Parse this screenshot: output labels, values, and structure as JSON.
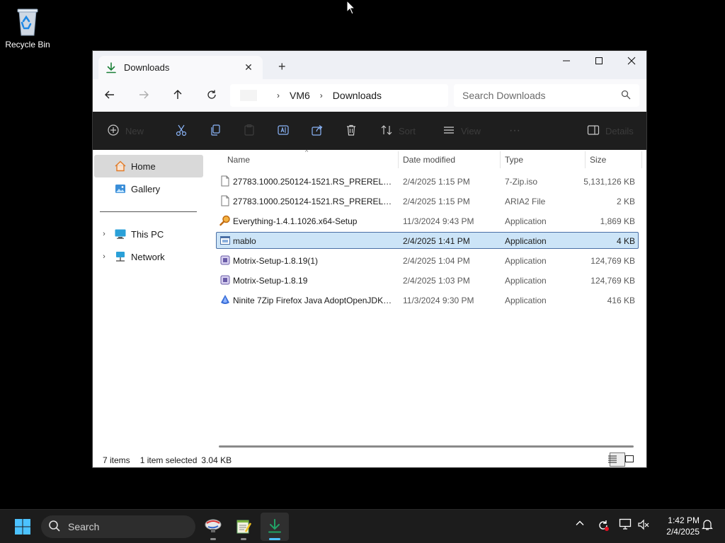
{
  "desktop": {
    "recycle_bin_label": "Recycle Bin"
  },
  "window": {
    "tab_title": "Downloads",
    "new_tab_symbol": "+",
    "close_tab_symbol": "✕",
    "controls": {
      "minimize_icon": "minimize-icon",
      "maximize_icon": "maximize-icon",
      "close_icon": "close-icon"
    }
  },
  "address": {
    "breadcrumbs": [
      "VM6",
      "Downloads"
    ],
    "search_placeholder": "Search Downloads"
  },
  "commandbar": {
    "new_label": "New",
    "sort_label": "Sort",
    "view_label": "View",
    "more_label": "···",
    "details_label": "Details"
  },
  "sidebar": {
    "items": [
      {
        "label": "Home",
        "icon": "home-icon"
      },
      {
        "label": "Gallery",
        "icon": "gallery-icon"
      },
      {
        "label": "This PC",
        "icon": "monitor-icon"
      },
      {
        "label": "Network",
        "icon": "network-icon"
      }
    ]
  },
  "columns": {
    "name": "Name",
    "date": "Date modified",
    "type": "Type",
    "size": "Size"
  },
  "files": [
    {
      "name": "27783.1000.250124-1521.RS_PRERELEASE_...",
      "date": "2/4/2025 1:15 PM",
      "type": "7-Zip.iso",
      "size": "5,131,126 KB",
      "icon": "document-icon"
    },
    {
      "name": "27783.1000.250124-1521.RS_PRERELEASE_...",
      "date": "2/4/2025 1:15 PM",
      "type": "ARIA2 File",
      "size": "2 KB",
      "icon": "document-icon"
    },
    {
      "name": "Everything-1.4.1.1026.x64-Setup",
      "date": "11/3/2024 9:43 PM",
      "type": "Application",
      "size": "1,869 KB",
      "icon": "magnifier-icon"
    },
    {
      "name": "mablo",
      "date": "2/4/2025 1:41 PM",
      "type": "Application",
      "size": "4 KB",
      "icon": "app-window-icon"
    },
    {
      "name": "Motrix-Setup-1.8.19(1)",
      "date": "2/4/2025 1:04 PM",
      "type": "Application",
      "size": "124,769 KB",
      "icon": "installer-icon"
    },
    {
      "name": "Motrix-Setup-1.8.19",
      "date": "2/4/2025 1:03 PM",
      "type": "Application",
      "size": "124,769 KB",
      "icon": "installer-icon"
    },
    {
      "name": "Ninite 7Zip Firefox Java AdoptOpenJDK x...",
      "date": "11/3/2024 9:30 PM",
      "type": "Application",
      "size": "416 KB",
      "icon": "ninite-icon"
    }
  ],
  "status": {
    "item_count": "7 items",
    "selection": "1 item selected",
    "selection_size": "3.04 KB"
  },
  "taskbar": {
    "search_label": "Search",
    "time": "1:42 PM",
    "date": "2/4/2025"
  },
  "colors": {
    "selection_bg": "#cce4f7",
    "selection_border": "#4a6fa5",
    "accent": "#4cc2ff",
    "commandbar_bg": "#1e1e1e"
  }
}
